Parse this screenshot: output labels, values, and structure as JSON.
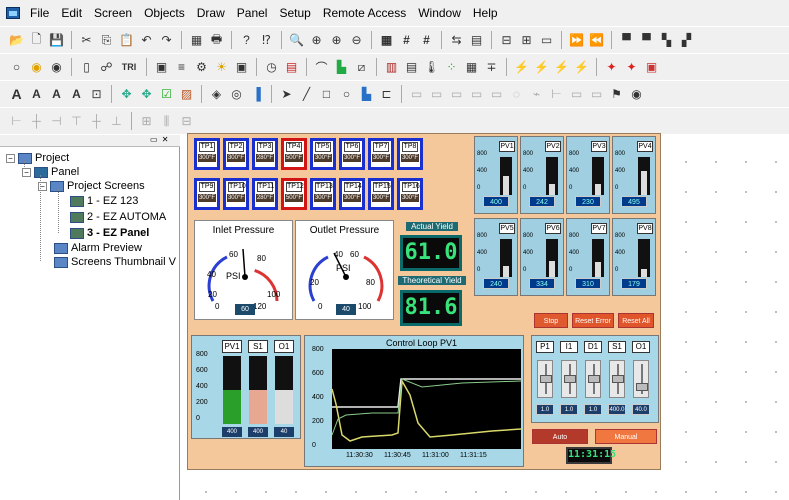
{
  "menu": {
    "items": [
      "File",
      "Edit",
      "Screen",
      "Objects",
      "Draw",
      "Panel",
      "Setup",
      "Remote Access",
      "Window",
      "Help"
    ]
  },
  "toolbar": {
    "tri": "TRI"
  },
  "tree": {
    "root": "Project",
    "panel": "Panel",
    "project_screens": "Project Screens",
    "screens": [
      "1 - EZ 123",
      "2 - EZ AUTOMA",
      "3 - EZ Panel"
    ],
    "alarm": "Alarm Preview",
    "thumbs": "Screens Thumbnail V"
  },
  "tp": {
    "row1": [
      [
        "TP1",
        "300°F",
        false
      ],
      [
        "TP2",
        "300°F",
        false
      ],
      [
        "TP3",
        "280°F",
        false
      ],
      [
        "TP4",
        "500°F",
        true
      ],
      [
        "TP5",
        "300°F",
        false
      ],
      [
        "TP6",
        "300°F",
        false
      ],
      [
        "TP7",
        "300°F",
        false
      ],
      [
        "TP8",
        "300°F",
        false
      ]
    ],
    "row2": [
      [
        "TP9",
        "300°F",
        false
      ],
      [
        "TP10",
        "300°F",
        false
      ],
      [
        "TP11",
        "280°F",
        false
      ],
      [
        "TP12",
        "500°F",
        true
      ],
      [
        "TP13",
        "300°F",
        false
      ],
      [
        "TP14",
        "300°F",
        false
      ],
      [
        "TP15",
        "300°F",
        false
      ],
      [
        "TP16",
        "300°F",
        false
      ]
    ]
  },
  "gauges": {
    "inlet": {
      "title": "Inlet Pressure",
      "unit": "PSI",
      "value": "60",
      "ticks": [
        "0",
        "20",
        "40",
        "60",
        "80",
        "100",
        "120"
      ]
    },
    "outlet": {
      "title": "Outlet Pressure",
      "unit": "PSI",
      "value": "40",
      "ticks": [
        "0",
        "20",
        "40",
        "60",
        "80",
        "100"
      ]
    }
  },
  "yield": {
    "actual_label": "Actual Yield",
    "actual": "61.0",
    "theo_label": "Theoretical Yield",
    "theo": "81.6"
  },
  "pv": [
    {
      "name": "PV1",
      "value": "400",
      "fill": 0.5
    },
    {
      "name": "PV2",
      "value": "242",
      "fill": 0.3
    },
    {
      "name": "PV3",
      "value": "230",
      "fill": 0.28
    },
    {
      "name": "PV4",
      "value": "495",
      "fill": 0.62
    },
    {
      "name": "PV5",
      "value": "240",
      "fill": 0.3
    },
    {
      "name": "PV6",
      "value": "334",
      "fill": 0.42
    },
    {
      "name": "PV7",
      "value": "310",
      "fill": 0.39
    },
    {
      "name": "PV8",
      "value": "179",
      "fill": 0.22
    }
  ],
  "pv_ticks": [
    "800",
    "400",
    "0"
  ],
  "buttons": {
    "stop": "Stop",
    "reset_error": "Reset Error",
    "reset_all": "Reset All",
    "auto": "Auto",
    "manual": "Manual"
  },
  "bars": {
    "labels": [
      "PV1",
      "S1",
      "O1"
    ],
    "values": [
      "400",
      "400",
      "40"
    ],
    "ticks": [
      "800",
      "600",
      "400",
      "200",
      "0"
    ]
  },
  "chart": {
    "title": "Control Loop PV1",
    "yticks": [
      "800",
      "600",
      "400",
      "200",
      "0"
    ],
    "xticks": [
      "11:30:30",
      "11:30:45",
      "11:31:00",
      "11:31:15"
    ]
  },
  "controls": {
    "labels": [
      "P1",
      "I1",
      "D1",
      "S1",
      "O1"
    ],
    "values": [
      "1.0",
      "1.0",
      "1.0",
      "400.0",
      "40.0"
    ]
  },
  "clock": "11:31:15"
}
